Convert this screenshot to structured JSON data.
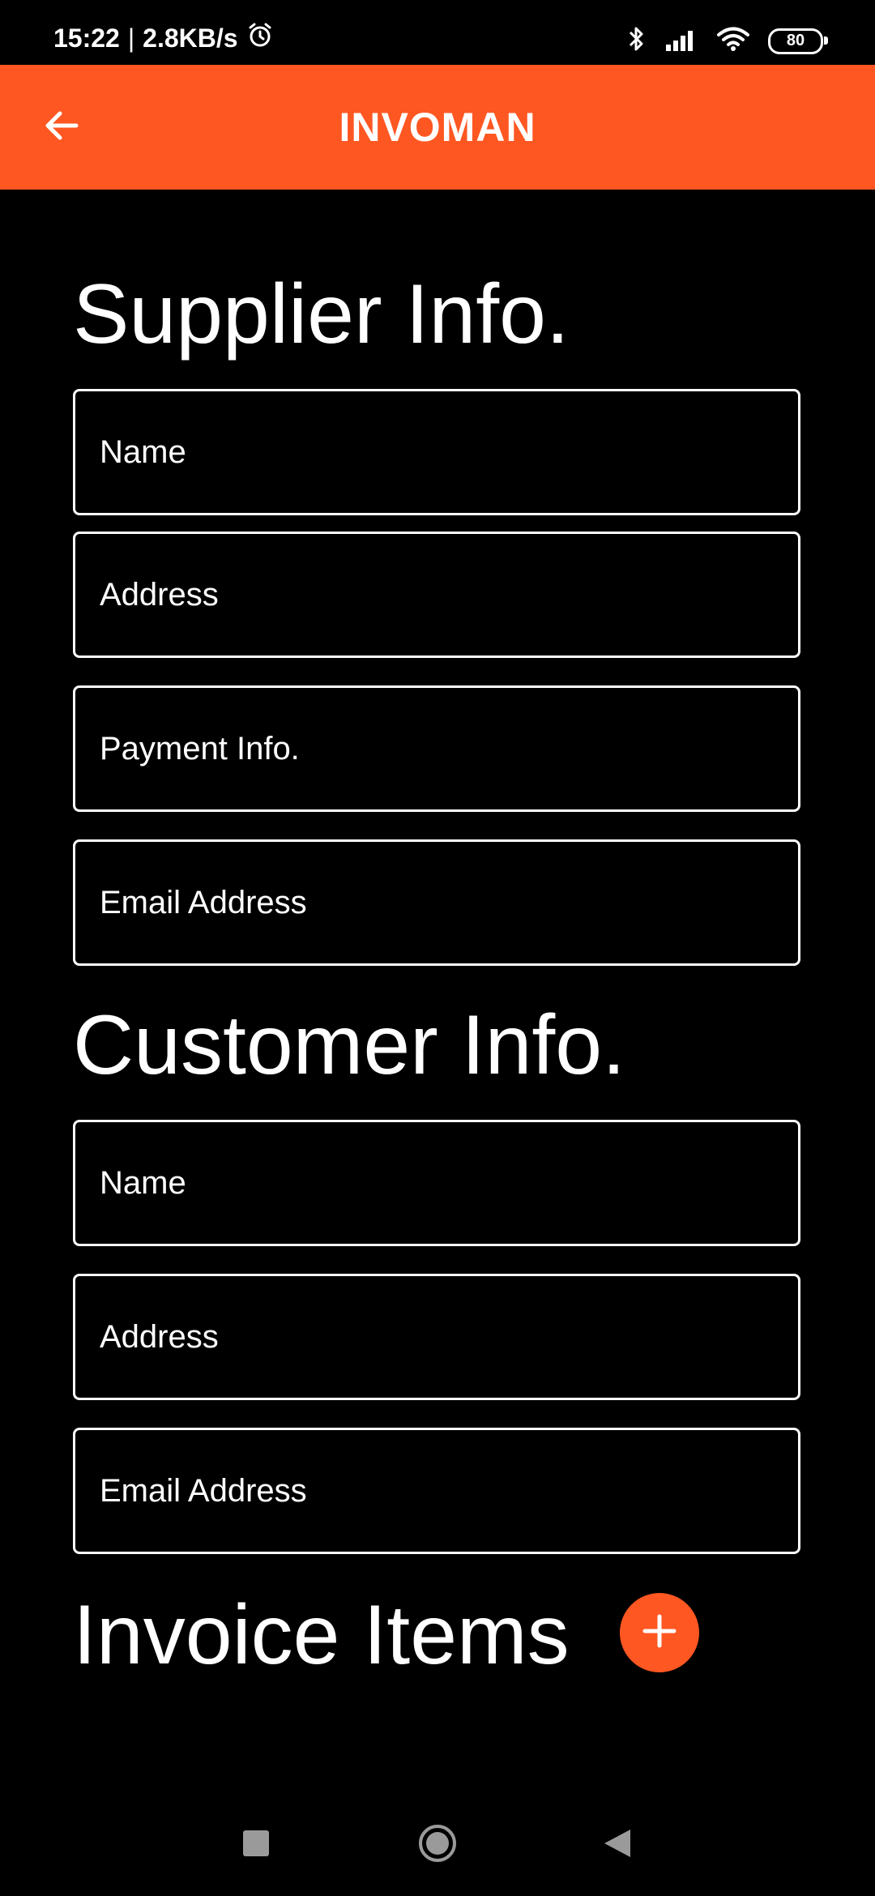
{
  "status_bar": {
    "time": "15:22",
    "separator": "|",
    "speed": "2.8KB/s",
    "battery": "80",
    "icons": [
      "alarm-icon",
      "bluetooth-icon",
      "signal-icon",
      "wifi-icon",
      "battery-icon"
    ]
  },
  "app_bar": {
    "title": "INVOMAN",
    "back_icon": "arrow-left-icon",
    "color": "#FF5722"
  },
  "supplier": {
    "title": "Supplier Info.",
    "fields": {
      "name": "Name",
      "address": "Address",
      "payment": "Payment Info.",
      "email": "Email Address"
    }
  },
  "customer": {
    "title": "Customer Info.",
    "fields": {
      "name": "Name",
      "address": "Address",
      "email": "Email Address"
    }
  },
  "invoice_items": {
    "title": "Invoice Items",
    "add_icon": "plus-icon"
  },
  "nav_bar": {
    "icons": [
      "recents-square-icon",
      "home-circle-icon",
      "back-triangle-icon"
    ]
  }
}
